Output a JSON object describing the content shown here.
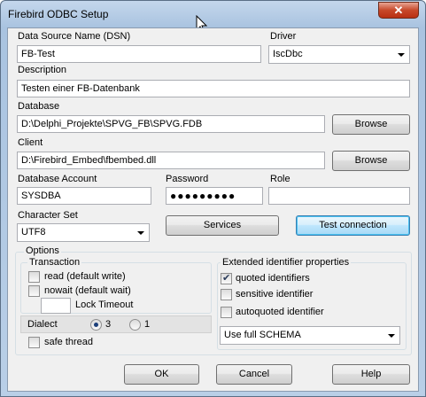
{
  "window": {
    "title": "Firebird ODBC Setup",
    "close_label": "✕"
  },
  "dsn": {
    "label": "Data Source Name (DSN)",
    "value": "FB-Test"
  },
  "driver": {
    "label": "Driver",
    "value": "IscDbc"
  },
  "description": {
    "label": "Description",
    "value": "Testen einer FB-Datenbank"
  },
  "database": {
    "label": "Database",
    "value": "D:\\Delphi_Projekte\\SPVG_FB\\SPVG.FDB",
    "browse_label": "Browse"
  },
  "client": {
    "label": "Client",
    "value": "D:\\Firebird_Embed\\fbembed.dll",
    "browse_label": "Browse"
  },
  "account": {
    "label": "Database Account",
    "value": "SYSDBA"
  },
  "password": {
    "label": "Password",
    "value": "●●●●●●●●●"
  },
  "role": {
    "label": "Role",
    "value": ""
  },
  "charset": {
    "label": "Character Set",
    "value": "UTF8"
  },
  "buttons": {
    "services": "Services",
    "test_connection": "Test connection",
    "ok": "OK",
    "cancel": "Cancel",
    "help": "Help"
  },
  "options": {
    "title": "Options",
    "transaction": {
      "title": "Transaction",
      "read_label": "read (default write)",
      "read_checked": false,
      "nowait_label": "nowait (default wait)",
      "nowait_checked": false,
      "lock_timeout_label": "Lock Timeout",
      "lock_timeout_value": ""
    },
    "dialect": {
      "label": "Dialect",
      "option3": "3",
      "option1": "1",
      "selected": "3"
    },
    "safe_thread": {
      "label": "safe thread",
      "checked": false
    },
    "extended": {
      "title": "Extended identifier properties",
      "quoted_label": "quoted identifiers",
      "quoted_checked": true,
      "sensitive_label": "sensitive identifier",
      "sensitive_checked": false,
      "autoquoted_label": "autoquoted identifier",
      "autoquoted_checked": false,
      "schema_value": "Use full SCHEMA"
    }
  }
}
